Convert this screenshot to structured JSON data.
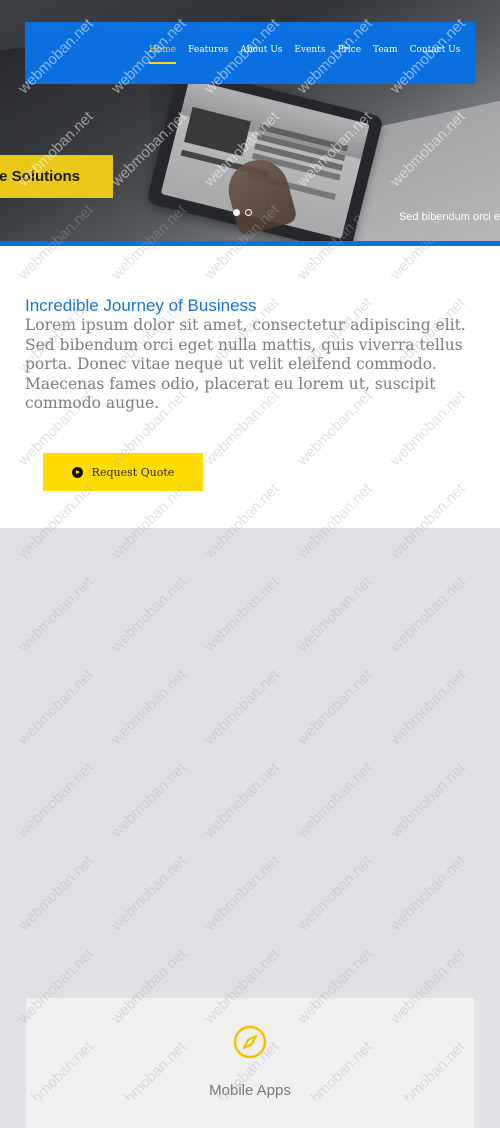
{
  "nav": {
    "items": [
      "Home",
      "Features",
      "About Us",
      "Events",
      "Price",
      "Team",
      "Contact Us"
    ],
    "active_index": 0
  },
  "hero": {
    "caption": "le Solutions",
    "subtext": "Sed bibendum orci e",
    "slide_count": 2,
    "active_slide": 1
  },
  "intro": {
    "title": "Incredible Journey of Business",
    "body": "Lorem ipsum dolor sit amet, consectetur adipiscing elit. Sed bibendum orci eget nulla mattis, quis viverra tellus porta. Donec vitae neque ut velit eleifend commodo. Maecenas fames odio, placerat eu lorem ut, suscipit commodo augue.",
    "button_label": "Request Quote",
    "button_icon": "play-circle-icon"
  },
  "service_card": {
    "icon": "compass-icon",
    "title": "Mobile Apps"
  },
  "watermark": "webmoban.net",
  "colors": {
    "primary_blue": "#0a70e0",
    "accent_yellow": "#ffdc00",
    "caption_yellow": "#e9c81a",
    "page_gray": "#e1e1e5",
    "icon_yellow": "#f2c200"
  }
}
